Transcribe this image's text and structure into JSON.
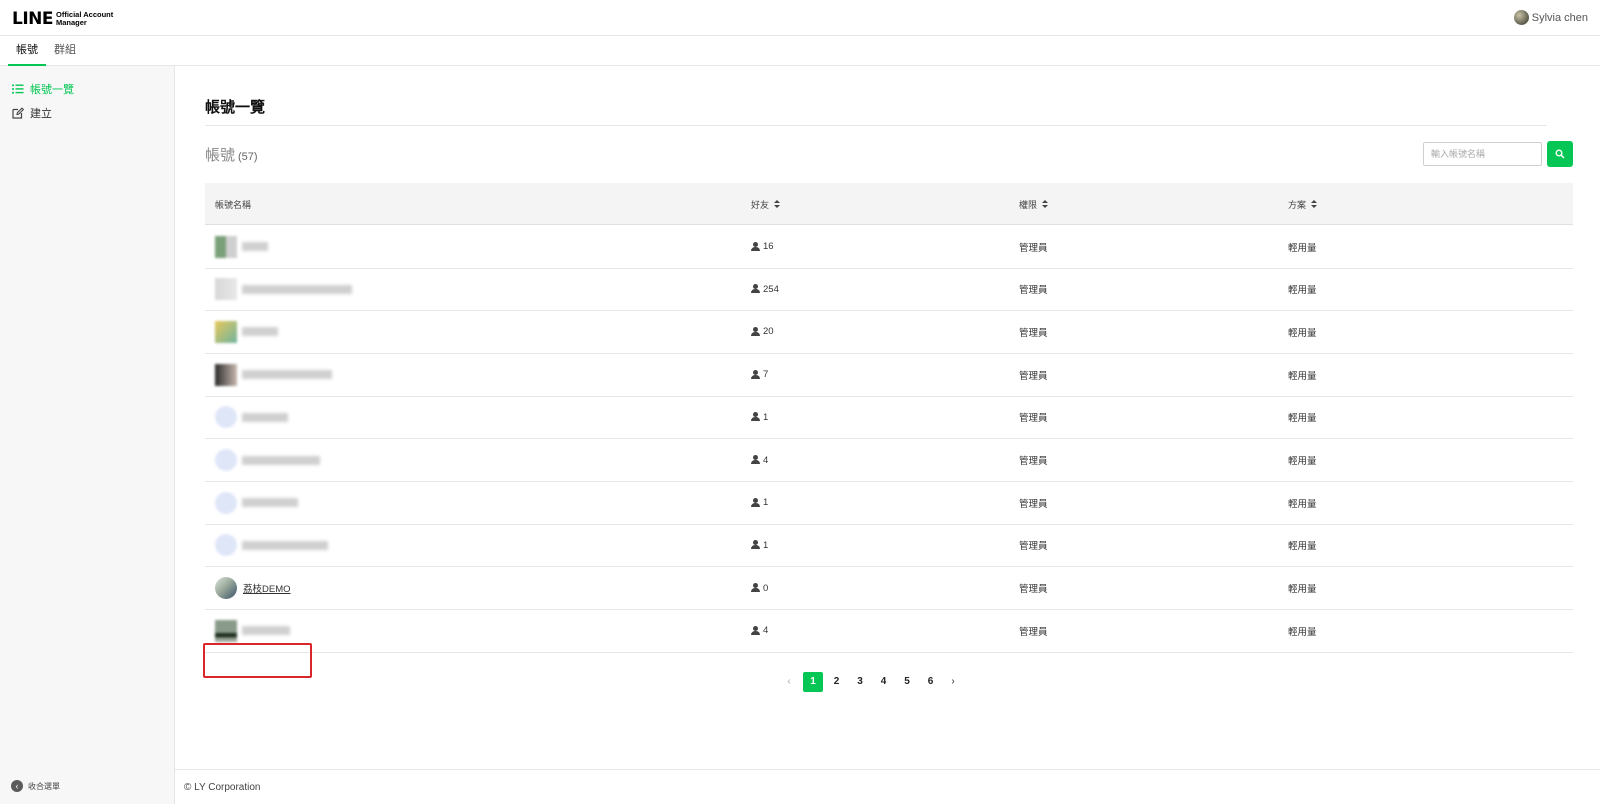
{
  "header": {
    "logo_main": "LINE",
    "logo_sub_1": "Official Account",
    "logo_sub_2": "Manager",
    "user_name": "Sylvia chen"
  },
  "tabs": [
    {
      "label": "帳號",
      "active": true
    },
    {
      "label": "群組",
      "active": false
    }
  ],
  "sidebar": {
    "items": [
      {
        "label": "帳號一覽",
        "icon": "list-icon",
        "active": true
      },
      {
        "label": "建立",
        "icon": "edit-icon",
        "active": false
      }
    ],
    "collapse_label": "收合選單"
  },
  "main": {
    "page_title": "帳號一覽",
    "accounts_label": "帳號",
    "accounts_count": "(57)",
    "search": {
      "placeholder": "輸入帳號名稱",
      "value": ""
    }
  },
  "table": {
    "headers": {
      "name": "帳號名稱",
      "friends": "好友",
      "role": "權限",
      "plan": "方案"
    },
    "rows": [
      {
        "name": "",
        "friends": "16",
        "role": "管理員",
        "plan": "輕用量"
      },
      {
        "name": "",
        "friends": "254",
        "role": "管理員",
        "plan": "輕用量"
      },
      {
        "name": "",
        "friends": "20",
        "role": "管理員",
        "plan": "輕用量"
      },
      {
        "name": "",
        "friends": "7",
        "role": "管理員",
        "plan": "輕用量"
      },
      {
        "name": "",
        "friends": "1",
        "role": "管理員",
        "plan": "輕用量"
      },
      {
        "name": "",
        "friends": "4",
        "role": "管理員",
        "plan": "輕用量"
      },
      {
        "name": "",
        "friends": "1",
        "role": "管理員",
        "plan": "輕用量"
      },
      {
        "name": "",
        "friends": "1",
        "role": "管理員",
        "plan": "輕用量"
      },
      {
        "name": "荔枝DEMO",
        "friends": "0",
        "role": "管理員",
        "plan": "輕用量"
      },
      {
        "name": "",
        "friends": "4",
        "role": "管理員",
        "plan": "輕用量"
      }
    ]
  },
  "pagination": {
    "pages": [
      "1",
      "2",
      "3",
      "4",
      "5",
      "6"
    ],
    "current": "1"
  },
  "footer": {
    "copyright": "© LY Corporation"
  },
  "colors": {
    "accent": "#06c755",
    "highlight": "#d8262a"
  }
}
